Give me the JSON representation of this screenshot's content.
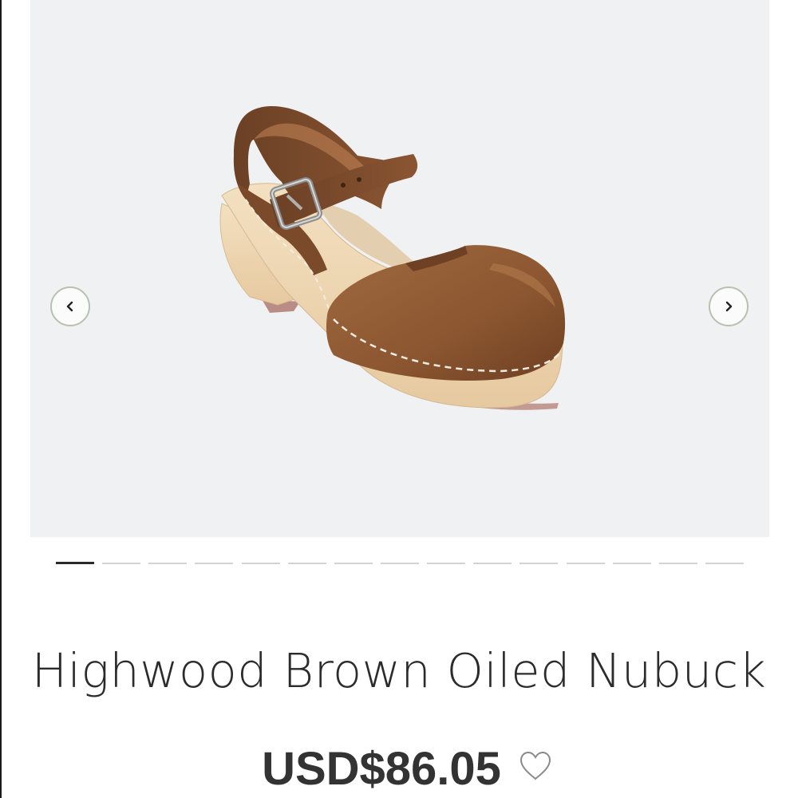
{
  "gallery": {
    "image_alt": "Highwood Brown Oiled Nubuck clog",
    "prev_icon": "chevron-left-icon",
    "next_icon": "chevron-right-icon",
    "slide_count": 15,
    "active_slide": 1
  },
  "product": {
    "title": "Highwood Brown Oiled Nubuck",
    "price": "USD$86.05",
    "wishlist_icon": "heart-icon"
  },
  "colors": {
    "gallery_background": "#f0f1f3",
    "leather": "#8a5530",
    "wood": "#efd9b6",
    "text": "#2b2b2b"
  }
}
